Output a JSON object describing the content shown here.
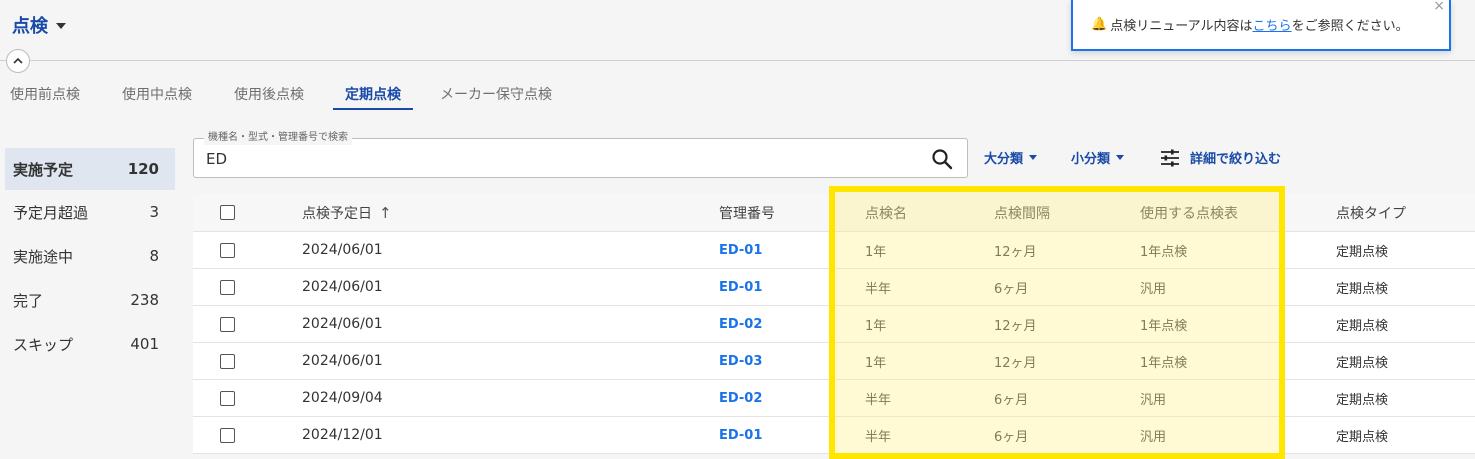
{
  "header": {
    "title": "点検"
  },
  "tabs": [
    {
      "label": "使用前点検",
      "active": false
    },
    {
      "label": "使用中点検",
      "active": false
    },
    {
      "label": "使用後点検",
      "active": false
    },
    {
      "label": "定期点検",
      "active": true
    },
    {
      "label": "メーカー保守点検",
      "active": false
    }
  ],
  "notification": {
    "text_before": "点検リニューアル内容は",
    "link": "こちら",
    "text_after": "をご参照ください。",
    "close": "×"
  },
  "sidebar": {
    "items": [
      {
        "label": "実施予定",
        "count": "120",
        "active": true
      },
      {
        "label": "予定月超過",
        "count": "3",
        "active": false
      },
      {
        "label": "実施途中",
        "count": "8",
        "active": false
      },
      {
        "label": "完了",
        "count": "238",
        "active": false
      },
      {
        "label": "スキップ",
        "count": "401",
        "active": false
      }
    ]
  },
  "search": {
    "label": "機種名・型式・管理番号で検索",
    "value": "ED"
  },
  "filters": {
    "major": "大分類",
    "minor": "小分類",
    "detail": "詳細で絞り込む"
  },
  "table": {
    "columns": {
      "date": "点検予定日",
      "sort_arrow": "↑",
      "id": "管理番号",
      "name": "点検名",
      "interval": "点検間隔",
      "sheet": "使用する点検表",
      "type": "点検タイプ"
    },
    "rows": [
      {
        "date": "2024/06/01",
        "id": "ED-01",
        "name": "1年",
        "interval": "12ヶ月",
        "sheet": "1年点検",
        "type": "定期点検"
      },
      {
        "date": "2024/06/01",
        "id": "ED-01",
        "name": "半年",
        "interval": "6ヶ月",
        "sheet": "汎用",
        "type": "定期点検"
      },
      {
        "date": "2024/06/01",
        "id": "ED-02",
        "name": "1年",
        "interval": "12ヶ月",
        "sheet": "1年点検",
        "type": "定期点検"
      },
      {
        "date": "2024/06/01",
        "id": "ED-03",
        "name": "1年",
        "interval": "12ヶ月",
        "sheet": "1年点検",
        "type": "定期点検"
      },
      {
        "date": "2024/09/04",
        "id": "ED-02",
        "name": "半年",
        "interval": "6ヶ月",
        "sheet": "汎用",
        "type": "定期点検"
      },
      {
        "date": "2024/12/01",
        "id": "ED-01",
        "name": "半年",
        "interval": "6ヶ月",
        "sheet": "汎用",
        "type": "定期点検"
      }
    ]
  },
  "colors": {
    "accent": "#1a4aa8",
    "link": "#1a73e8",
    "highlight": "#ffe600"
  }
}
